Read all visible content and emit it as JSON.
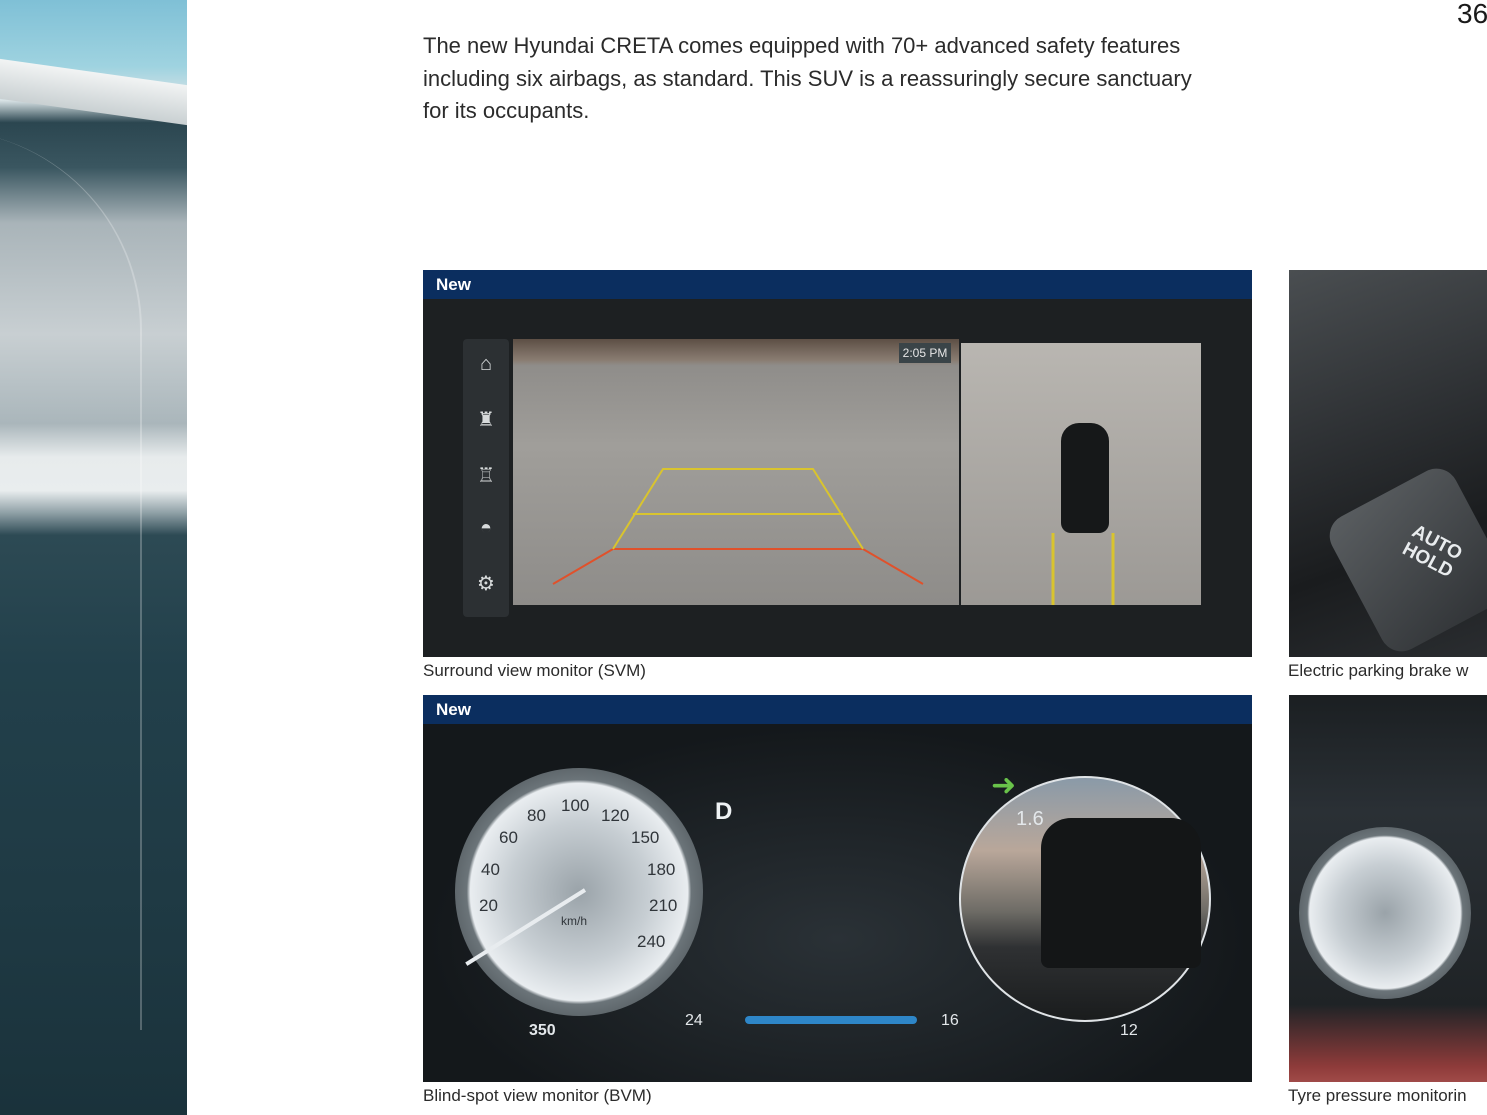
{
  "page": {
    "number": "36",
    "intro": "The new Hyundai CRETA comes equipped with 70+ advanced safety features including six airbags, as standard. This SUV is a reassuringly secure sanctuary for its occupants."
  },
  "cards": {
    "svm": {
      "badge": "New",
      "caption": "Surround view monitor (SVM)",
      "screen_time": "2:05 PM",
      "sidebar_icons": [
        "home-icon",
        "parking-sensor-icon",
        "sensor-off-icon",
        "car-view-icon",
        "gear-icon"
      ]
    },
    "epb": {
      "caption": "Electric parking brake w",
      "button_text": "AUTO HOLD"
    },
    "bvm": {
      "badge": "New",
      "caption": "Blind-spot view monitor (BVM)",
      "gear": "D",
      "range": "350",
      "temperature": "24",
      "speed_unit": "km/h",
      "economy": "16",
      "trip": "12",
      "distance": "1.6",
      "speedo_labels": [
        "20",
        "40",
        "60",
        "80",
        "100",
        "120",
        "150",
        "180",
        "210",
        "240"
      ]
    },
    "tpms": {
      "caption": "Tyre pressure monitorin"
    }
  }
}
